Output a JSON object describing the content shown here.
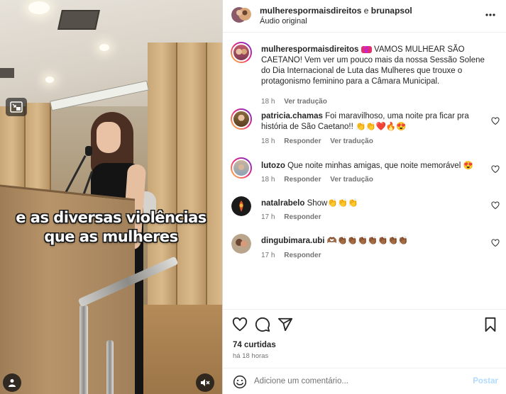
{
  "video": {
    "caption_line1": "e as diversas violências",
    "caption_line2": "que as mulheres",
    "pip_icon": "picture-in-picture-icon",
    "tag_icon": "user-tag-icon",
    "mute_icon": "speaker-muted-icon"
  },
  "header": {
    "user1": "mulherespormaisdireitos",
    "separator": "e",
    "user2": "brunapsol",
    "audio": "Áudio original",
    "more_icon": "more-horizontal-icon"
  },
  "caption_post": {
    "user": "mulherespormaisdireitos",
    "emoji": "♀️",
    "text": "VAMOS MULHEAR SÃO CAETANO! Vem ver um pouco mais da nossa Sessão Solene do Dia Internacional de Luta das Mulheres que trouxe o protagonismo feminino para a Câmara Municipal.",
    "time": "18 h",
    "translate": "Ver tradução"
  },
  "comments": [
    {
      "user": "patricia.chamas",
      "text": "Foi maravilhoso, uma noite pra ficar pra história de São Caetano!! 👏👏❤️🔥😍",
      "time": "18 h",
      "reply": "Responder",
      "translate": "Ver tradução"
    },
    {
      "user": "lutozo",
      "text": "Que noite minhas amigas, que noite memorável 😍",
      "time": "18 h",
      "reply": "Responder",
      "translate": "Ver tradução"
    },
    {
      "user": "natalrabelo",
      "text": "Show👏👏👏",
      "time": "17 h",
      "reply": "Responder"
    },
    {
      "user": "dingubimara.ubi",
      "text": "🫶🏾👏🏾👏🏾👏🏾👏🏾👏🏾👏🏾👏🏾",
      "time": "17 h",
      "reply": "Responder"
    }
  ],
  "actions": {
    "like_icon": "heart-icon",
    "comment_icon": "comment-icon",
    "share_icon": "send-icon",
    "save_icon": "bookmark-icon",
    "likes": "74 curtidas",
    "ago": "há 18 horas"
  },
  "add_comment": {
    "emoji_icon": "emoji-icon",
    "placeholder": "Adicione um comentário...",
    "post_label": "Postar"
  },
  "colors": {
    "accent": "#0095f6",
    "post_disabled": "#b3dbff",
    "secondary_text": "#737373",
    "primary_text": "#262626"
  }
}
